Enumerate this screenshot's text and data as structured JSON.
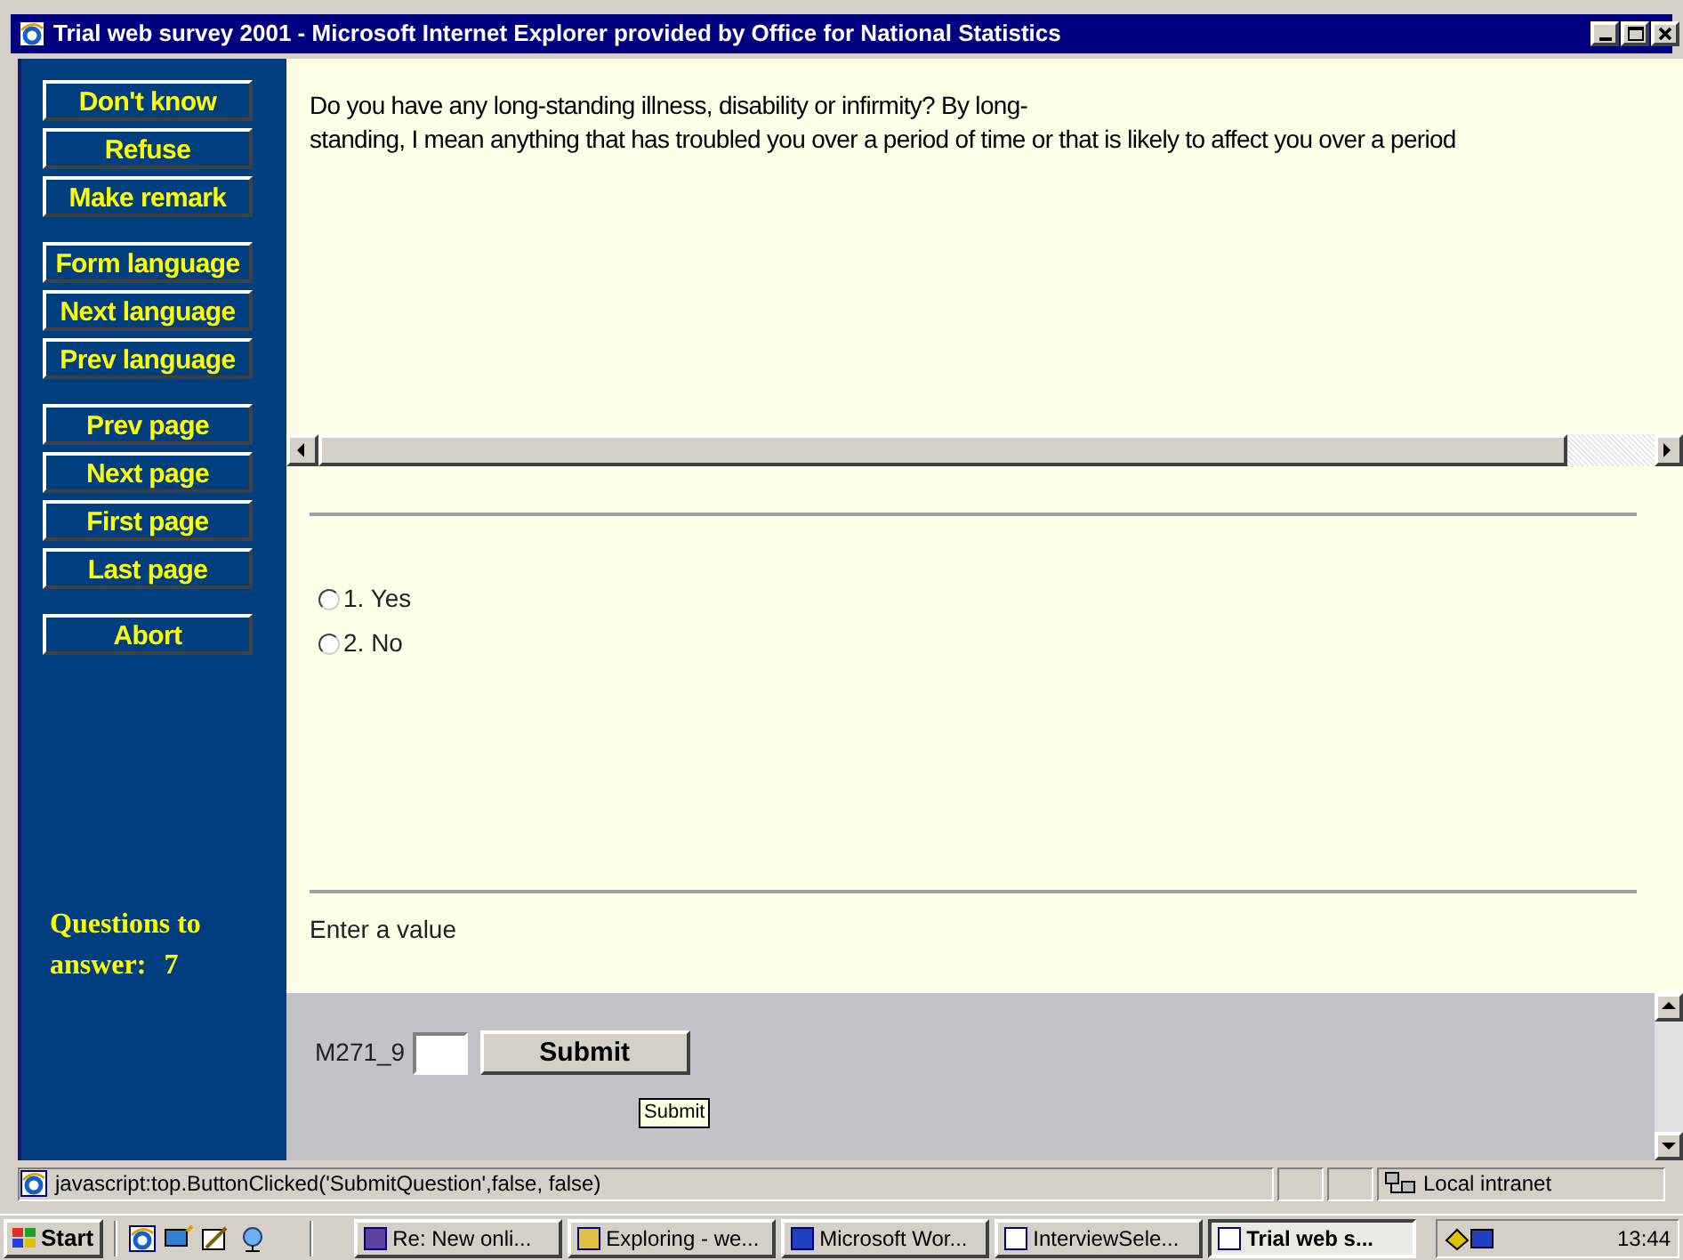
{
  "window": {
    "title": "Trial web survey 2001 - Microsoft Internet Explorer provided by Office for National Statistics"
  },
  "sidebar": {
    "button_groups": [
      [
        "Don't know",
        "Refuse",
        "Make remark"
      ],
      [
        "Form language",
        "Next language",
        "Prev language"
      ],
      [
        "Prev page",
        "Next page",
        "First page",
        "Last page"
      ],
      [
        "Abort"
      ]
    ],
    "questions_label": "Questions to",
    "answer_label": "answer:",
    "questions_count": "7"
  },
  "question": {
    "lines": [
      "Do you have any long-standing illness, disability or infirmity? By long-",
      "standing, I mean anything that has troubled you over a period of time or that is likely to affect you over a period"
    ]
  },
  "options": [
    {
      "label": "1. Yes",
      "selected": false
    },
    {
      "label": "2. No",
      "selected": false
    }
  ],
  "hint": "Enter a value",
  "answer": {
    "field_label": "M271_9",
    "button": "Submit",
    "tooltip": "Submit"
  },
  "status_bar": {
    "text": "javascript:top.ButtonClicked('SubmitQuestion',false, false)",
    "zone": "Local intranet"
  },
  "taskbar": {
    "start": "Start",
    "tasks": [
      {
        "label": "Re: New onli...",
        "selected": false
      },
      {
        "label": "Exploring - we...",
        "selected": false
      },
      {
        "label": "Microsoft Wor...",
        "selected": false
      },
      {
        "label": "InterviewSele...",
        "selected": false
      },
      {
        "label": "Trial web s...",
        "selected": true
      }
    ],
    "clock": "13:44"
  }
}
